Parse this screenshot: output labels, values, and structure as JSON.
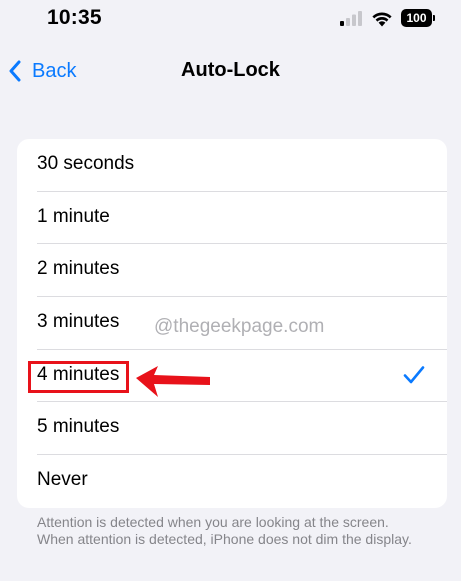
{
  "status_bar": {
    "time": "10:35",
    "battery": "100"
  },
  "nav": {
    "back_label": "Back",
    "title": "Auto-Lock"
  },
  "options": [
    {
      "label": "30 seconds",
      "selected": false
    },
    {
      "label": "1 minute",
      "selected": false
    },
    {
      "label": "2 minutes",
      "selected": false
    },
    {
      "label": "3 minutes",
      "selected": false
    },
    {
      "label": "4 minutes",
      "selected": true
    },
    {
      "label": "5 minutes",
      "selected": false
    },
    {
      "label": "Never",
      "selected": false
    }
  ],
  "footer": "Attention is detected when you are looking at the screen. When attention is detected, iPhone does not dim the display.",
  "watermark": "@thegeekpage.com",
  "colors": {
    "accent": "#0a7aff",
    "annotation": "#e8121a",
    "background": "#f2f2f7"
  }
}
